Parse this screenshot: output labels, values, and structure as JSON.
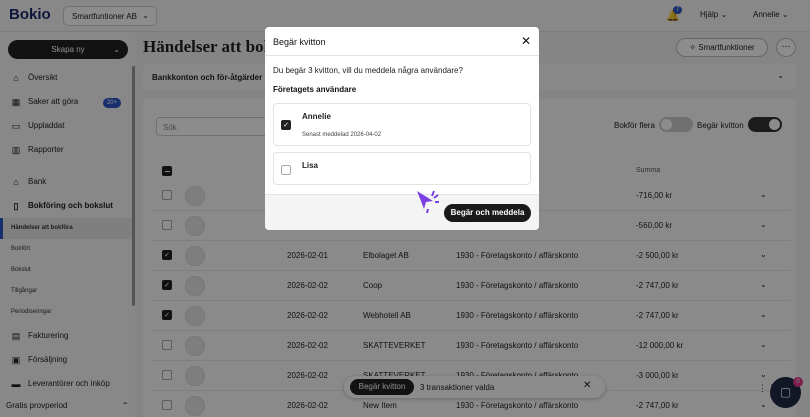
{
  "header": {
    "logo": "Bokio",
    "company": "Smartfuntioner AB",
    "notification_count": "7",
    "help_label": "Hjälp",
    "user_label": "Annelie"
  },
  "sidebar": {
    "create_label": "Skapa ny",
    "items": [
      {
        "label": "Översikt",
        "icon": "home-icon"
      },
      {
        "label": "Saker att göra",
        "icon": "calendar-icon",
        "badge": "20+"
      },
      {
        "label": "Uppladdat",
        "icon": "folder-icon"
      },
      {
        "label": "Rapporter",
        "icon": "chart-icon"
      },
      {
        "label": "Bank",
        "icon": "bank-icon"
      },
      {
        "label": "Bokföring och bokslut",
        "icon": "book-icon"
      }
    ],
    "subitems": [
      {
        "label": "Händelser att bokföra",
        "active": true
      },
      {
        "label": "Bokfört"
      },
      {
        "label": "Bokslut"
      },
      {
        "label": "Tillgångar"
      },
      {
        "label": "Periodiseringar"
      }
    ],
    "items2": [
      {
        "label": "Fakturering",
        "icon": "invoice-icon"
      },
      {
        "label": "Försäljning",
        "icon": "store-icon"
      },
      {
        "label": "Leverantörer och inköp",
        "icon": "truck-icon"
      }
    ],
    "promo": "Gratis provperiod"
  },
  "main": {
    "title": "Händelser att bokföra",
    "smart_label": "Smartfunktioner",
    "bank_bar_label": "Bankkonton och för-åtgärder",
    "search_placeholder": "Sök",
    "toggle1_label": "Bokför flera",
    "toggle2_label": "Begär kvitton",
    "amount_header": "Summa",
    "rows": [
      {
        "date": "",
        "name": "",
        "account": "",
        "amount": "-716,00 kr",
        "checked": false
      },
      {
        "date": "",
        "name": "",
        "account": "",
        "amount": "-560,00 kr",
        "checked": false
      },
      {
        "date": "2026-02-01",
        "name": "Elbolaget AB",
        "account": "1930 - Företagskonto / affärskonto",
        "amount": "-2 500,00 kr",
        "checked": true
      },
      {
        "date": "2026-02-02",
        "name": "Coop",
        "account": "1930 - Företagskonto / affärskonto",
        "amount": "-2 747,00 kr",
        "checked": true
      },
      {
        "date": "2026-02-02",
        "name": "Webhotell AB",
        "account": "1930 - Företagskonto / affärskonto",
        "amount": "-2 747,00 kr",
        "checked": true
      },
      {
        "date": "2026-02-02",
        "name": "SKATTEVERKET",
        "account": "1930 - Företagskonto / affärskonto",
        "amount": "-12 000,00 kr",
        "checked": false
      },
      {
        "date": "2026-02-02",
        "name": "SKATTEVERKET",
        "account": "1930 - Företagskonto / affärskonto",
        "amount": "-3 000,00 kr",
        "checked": false
      },
      {
        "date": "2026-02-02",
        "name": "New Item",
        "account": "1930 - Företagskonto / affärskonto",
        "amount": "-2 747,00 kr",
        "checked": false
      }
    ],
    "bulk_button": "Begär kvitton",
    "bulk_text": "3 transaktioner valda",
    "chat_badge": "0"
  },
  "modal": {
    "title": "Begär kvitton",
    "question": "Du begär 3 kvitton, vill du meddela några användare?",
    "subtitle": "Företagets användare",
    "users": [
      {
        "name": "Annelie",
        "meta": "Senast meddelad 2026-04-02",
        "checked": true
      },
      {
        "name": "Lisa",
        "meta": "",
        "checked": false
      }
    ],
    "submit_label": "Begär och meddela"
  },
  "colors": {
    "brand": "#1a2a6c",
    "accent": "#2a56c6",
    "pointer": "#7b3fe4",
    "dark": "#1a1a1a"
  }
}
